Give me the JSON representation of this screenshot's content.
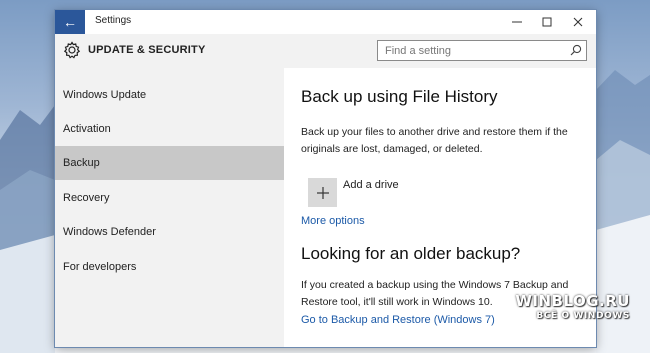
{
  "window": {
    "title": "Settings",
    "back_glyph": "←",
    "minimize_glyph": "—",
    "maximize_glyph": "☐",
    "close_glyph": "✕"
  },
  "header": {
    "title": "UPDATE & SECURITY",
    "icon": "gear-icon"
  },
  "search": {
    "placeholder": "Find a setting",
    "value": "",
    "icon": "search-icon"
  },
  "sidebar": {
    "items": [
      {
        "label": "Windows Update",
        "active": false
      },
      {
        "label": "Activation",
        "active": false
      },
      {
        "label": "Backup",
        "active": true
      },
      {
        "label": "Recovery",
        "active": false
      },
      {
        "label": "Windows Defender",
        "active": false
      },
      {
        "label": "For developers",
        "active": false
      }
    ]
  },
  "content": {
    "file_history_heading": "Back up using File History",
    "file_history_desc": "Back up your files to another drive and restore them if the originals are lost, damaged, or deleted.",
    "add_drive_label": "Add a drive",
    "more_options_link": "More options",
    "older_backup_heading": "Looking for an older backup?",
    "older_backup_desc": "If you created a backup using the Windows 7 Backup and Restore tool, it'll still work in Windows 10.",
    "restore_link": "Go to Backup and Restore (Windows 7)"
  },
  "watermark": {
    "line1": "WINBLOG.RU",
    "line2": "ВСЁ О WINDOWS"
  },
  "colors": {
    "accent": "#2b579a",
    "link": "#1c5aa8",
    "sidebar_bg": "#f2f2f2",
    "active_item": "#c8c8c8"
  }
}
